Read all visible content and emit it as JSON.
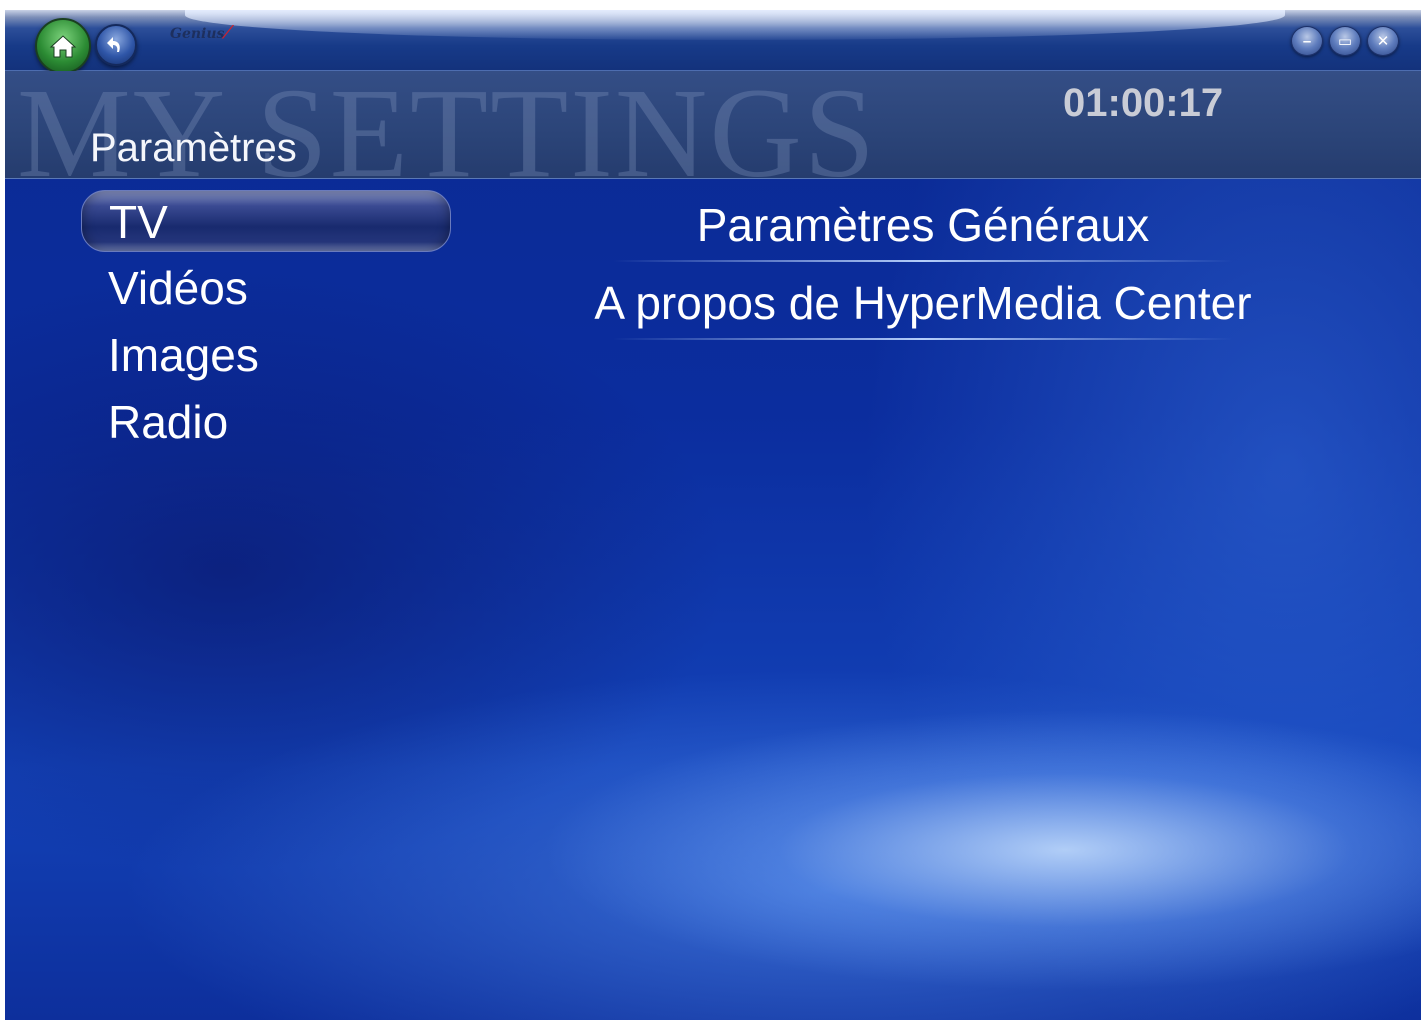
{
  "app": {
    "logo_text": "Genius",
    "watermark": "MY SETTINGS",
    "page_title": "Paramètres",
    "clock": "01:00:17"
  },
  "titlebar": {
    "home_icon": "home-icon",
    "back_icon": "back-arrow-icon",
    "minimize_glyph": "–",
    "maximize_glyph": "▭",
    "close_glyph": "✕"
  },
  "menu": {
    "items": [
      {
        "label": "TV",
        "selected": true
      },
      {
        "label": "Vidéos",
        "selected": false
      },
      {
        "label": "Images",
        "selected": false
      },
      {
        "label": "Radio",
        "selected": false
      }
    ]
  },
  "options": {
    "items": [
      {
        "label": "Paramètres Généraux"
      },
      {
        "label": "A propos de HyperMedia Center"
      }
    ]
  },
  "colors": {
    "background": "#0b2d9e",
    "home_button": "#2c8c34",
    "text": "#ffffff",
    "clock": "#c9ccd6"
  }
}
